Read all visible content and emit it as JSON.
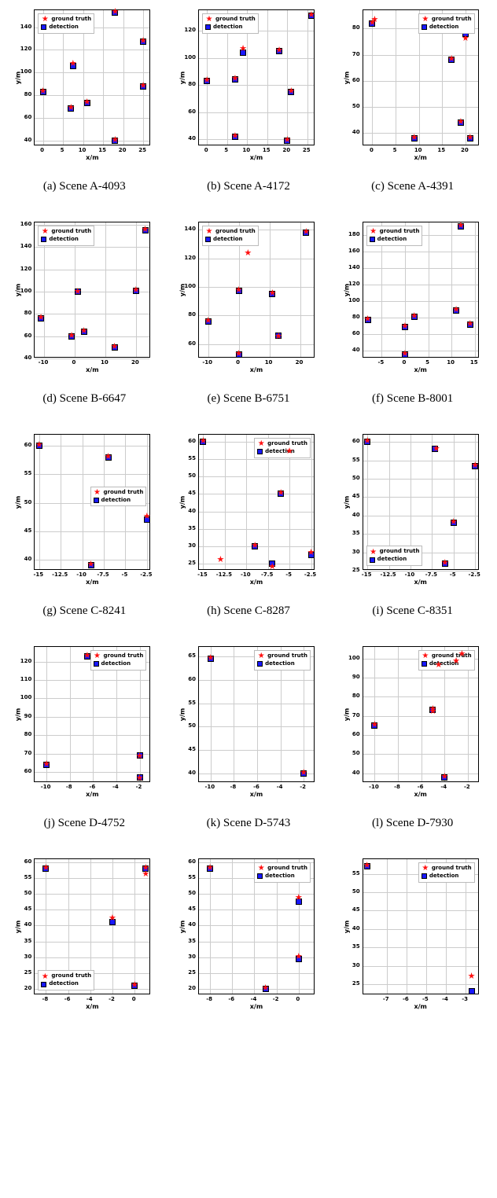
{
  "legend": {
    "gt": "ground truth",
    "det": "detection"
  },
  "xlabel": "x/m",
  "ylabel": "y/m",
  "chart_data": [
    {
      "id": "a",
      "caption": "(a) Scene A-4093",
      "type": "scatter",
      "xlabel": "x/m",
      "ylabel": "y/m",
      "xticks": [
        0,
        5,
        10,
        15,
        20,
        25
      ],
      "yticks": [
        40,
        60,
        80,
        100,
        120,
        140
      ],
      "xlim": [
        -2,
        27
      ],
      "ylim": [
        35,
        155
      ],
      "legend_pos": "upper-left",
      "gt": [
        [
          0,
          83
        ],
        [
          7,
          68
        ],
        [
          7.5,
          107
        ],
        [
          11,
          73
        ],
        [
          18,
          40
        ],
        [
          18,
          153
        ],
        [
          25,
          88
        ],
        [
          25,
          127
        ]
      ],
      "det": [
        [
          0,
          83
        ],
        [
          7,
          68
        ],
        [
          7.5,
          106
        ],
        [
          11,
          73
        ],
        [
          18,
          40
        ],
        [
          18,
          153
        ],
        [
          25,
          88
        ],
        [
          25,
          127
        ]
      ]
    },
    {
      "id": "b",
      "caption": "(b) Scene A-4172",
      "type": "scatter",
      "xlabel": "x/m",
      "ylabel": "y/m",
      "xticks": [
        0,
        5,
        10,
        15,
        20,
        25
      ],
      "yticks": [
        40,
        60,
        80,
        100,
        120
      ],
      "xlim": [
        -2,
        27
      ],
      "ylim": [
        35,
        135
      ],
      "legend_pos": "upper-left",
      "gt": [
        [
          0,
          83
        ],
        [
          7,
          42
        ],
        [
          7,
          84
        ],
        [
          9,
          106
        ],
        [
          18,
          105
        ],
        [
          20,
          39
        ],
        [
          21,
          75
        ],
        [
          26,
          131
        ]
      ],
      "det": [
        [
          0,
          83
        ],
        [
          7,
          42
        ],
        [
          7,
          84
        ],
        [
          9,
          104
        ],
        [
          18,
          105
        ],
        [
          20,
          39
        ],
        [
          21,
          75
        ],
        [
          26,
          131
        ]
      ]
    },
    {
      "id": "c",
      "caption": "(c) Scene A-4391",
      "type": "scatter",
      "xlabel": "x/m",
      "ylabel": "y/m",
      "xticks": [
        0,
        5,
        10,
        15,
        20
      ],
      "yticks": [
        40,
        50,
        60,
        70,
        80
      ],
      "xlim": [
        -2,
        23
      ],
      "ylim": [
        35,
        87
      ],
      "legend_pos": "upper-right",
      "gt": [
        [
          0,
          82
        ],
        [
          0.5,
          83
        ],
        [
          9,
          38
        ],
        [
          17,
          68
        ],
        [
          19,
          44
        ],
        [
          20,
          76
        ],
        [
          21,
          38
        ]
      ],
      "det": [
        [
          0,
          82
        ],
        [
          9,
          38
        ],
        [
          17,
          68
        ],
        [
          19,
          44
        ],
        [
          20,
          78
        ],
        [
          21,
          38
        ]
      ]
    },
    {
      "id": "d",
      "caption": "(d) Scene B-6647",
      "type": "scatter",
      "xlabel": "x/m",
      "ylabel": "y/m",
      "xticks": [
        -10,
        0,
        10,
        20
      ],
      "yticks": [
        40,
        60,
        80,
        100,
        120,
        140,
        160
      ],
      "xlim": [
        -13,
        25
      ],
      "ylim": [
        40,
        162
      ],
      "legend_pos": "upper-left",
      "gt": [
        [
          -11,
          76
        ],
        [
          -1,
          60
        ],
        [
          1,
          99
        ],
        [
          3,
          64
        ],
        [
          13,
          50
        ],
        [
          20,
          101
        ],
        [
          23,
          155
        ]
      ],
      "det": [
        [
          -11,
          76
        ],
        [
          -1,
          60
        ],
        [
          1,
          100
        ],
        [
          3,
          64
        ],
        [
          13,
          50
        ],
        [
          20,
          101
        ],
        [
          23,
          155
        ]
      ]
    },
    {
      "id": "e",
      "caption": "(e) Scene B-6751",
      "type": "scatter",
      "xlabel": "x/m",
      "ylabel": "y/m",
      "xticks": [
        -10,
        0,
        10,
        20
      ],
      "yticks": [
        60,
        80,
        100,
        120,
        140
      ],
      "xlim": [
        -13,
        25
      ],
      "ylim": [
        50,
        145
      ],
      "legend_pos": "upper-left",
      "gt": [
        [
          -10,
          76
        ],
        [
          0,
          53
        ],
        [
          0,
          97
        ],
        [
          3,
          123
        ],
        [
          11,
          95
        ],
        [
          13,
          65
        ],
        [
          22,
          138
        ]
      ],
      "det": [
        [
          -10,
          76
        ],
        [
          0,
          53
        ],
        [
          0,
          97
        ],
        [
          11,
          95
        ],
        [
          13,
          66
        ],
        [
          22,
          138
        ]
      ]
    },
    {
      "id": "f",
      "caption": "(f) Scene B-8001",
      "type": "scatter",
      "xlabel": "x/m",
      "ylabel": "y/m",
      "xticks": [
        -5,
        0,
        5,
        10,
        15
      ],
      "yticks": [
        40,
        60,
        80,
        100,
        120,
        140,
        160,
        180
      ],
      "xlim": [
        -9,
        16
      ],
      "ylim": [
        30,
        195
      ],
      "legend_pos": "upper-left",
      "gt": [
        [
          -8,
          77
        ],
        [
          0,
          35
        ],
        [
          0,
          68
        ],
        [
          2,
          81
        ],
        [
          11,
          88
        ],
        [
          12,
          190
        ],
        [
          14,
          71
        ]
      ],
      "det": [
        [
          -8,
          77
        ],
        [
          0,
          35
        ],
        [
          0,
          68
        ],
        [
          2,
          81
        ],
        [
          11,
          88
        ],
        [
          12,
          190
        ],
        [
          14,
          71
        ]
      ]
    },
    {
      "id": "g",
      "caption": "(g) Scene C-8241",
      "type": "scatter",
      "xlabel": "x/m",
      "ylabel": "y/m",
      "xticks": [
        -15.0,
        -12.5,
        -10.0,
        -7.5,
        -5.0,
        -2.5
      ],
      "yticks": [
        40,
        45,
        50,
        55,
        60
      ],
      "xlim": [
        -15.5,
        -2
      ],
      "ylim": [
        38,
        62
      ],
      "legend_pos": "center-right",
      "gt": [
        [
          -15,
          60
        ],
        [
          -9,
          39
        ],
        [
          -7,
          58
        ],
        [
          -2.5,
          47.5
        ]
      ],
      "det": [
        [
          -15,
          60
        ],
        [
          -9,
          39
        ],
        [
          -7,
          58
        ],
        [
          -2.5,
          47
        ]
      ]
    },
    {
      "id": "h",
      "caption": "(h) Scene C-8287",
      "type": "scatter",
      "xlabel": "x/m",
      "ylabel": "y/m",
      "xticks": [
        -15.0,
        -12.5,
        -10.0,
        -7.5,
        -5.0,
        -2.5
      ],
      "yticks": [
        25,
        30,
        35,
        40,
        45,
        50,
        55,
        60
      ],
      "xlim": [
        -15.5,
        -2
      ],
      "ylim": [
        23,
        62
      ],
      "legend_pos": "upper-right",
      "gt": [
        [
          -15,
          60
        ],
        [
          -13,
          26
        ],
        [
          -9,
          30
        ],
        [
          -7,
          24
        ],
        [
          -6,
          45
        ],
        [
          -5,
          57
        ],
        [
          -2.5,
          28
        ]
      ],
      "det": [
        [
          -15,
          60
        ],
        [
          -9,
          30
        ],
        [
          -7,
          25
        ],
        [
          -6,
          45
        ],
        [
          -5,
          56.5
        ],
        [
          -2.5,
          27.5
        ]
      ]
    },
    {
      "id": "i",
      "caption": "(i) Scene C-8351",
      "type": "scatter",
      "xlabel": "x/m",
      "ylabel": "y/m",
      "xticks": [
        -15.0,
        -12.5,
        -10.0,
        -7.5,
        -5.0,
        -2.5
      ],
      "yticks": [
        25,
        30,
        35,
        40,
        45,
        50,
        55,
        60
      ],
      "xlim": [
        -15.5,
        -2
      ],
      "ylim": [
        25,
        62
      ],
      "legend_pos": "lower-left",
      "gt": [
        [
          -15,
          60
        ],
        [
          -7,
          58
        ],
        [
          -6,
          27
        ],
        [
          -5,
          38
        ],
        [
          -2.5,
          53.5
        ]
      ],
      "det": [
        [
          -15,
          60
        ],
        [
          -7.2,
          58.2
        ],
        [
          -6,
          27
        ],
        [
          -5,
          38
        ],
        [
          -2.5,
          53.5
        ]
      ]
    },
    {
      "id": "j",
      "caption": "(j) Scene D-4752",
      "type": "scatter",
      "xlabel": "x/m",
      "ylabel": "y/m",
      "xticks": [
        -10,
        -8,
        -6,
        -4,
        -2
      ],
      "yticks": [
        60,
        70,
        80,
        90,
        100,
        110,
        120
      ],
      "xlim": [
        -11,
        -1
      ],
      "ylim": [
        54,
        128
      ],
      "legend_pos": "upper-right",
      "gt": [
        [
          -10,
          64
        ],
        [
          -6.5,
          123
        ],
        [
          -2,
          56
        ],
        [
          -2,
          68
        ]
      ],
      "det": [
        [
          -10,
          64
        ],
        [
          -6.5,
          123
        ],
        [
          -2,
          57
        ],
        [
          -2,
          69
        ]
      ]
    },
    {
      "id": "k",
      "caption": "(k) Scene D-5743",
      "type": "scatter",
      "xlabel": "x/m",
      "ylabel": "y/m",
      "xticks": [
        -10,
        -8,
        -6,
        -4,
        -2
      ],
      "yticks": [
        40,
        45,
        50,
        55,
        60,
        65
      ],
      "xlim": [
        -11,
        -1
      ],
      "ylim": [
        38,
        67
      ],
      "legend_pos": "upper-right",
      "gt": [
        [
          -10,
          64.5
        ],
        [
          -2,
          40
        ]
      ],
      "det": [
        [
          -10,
          64.5
        ],
        [
          -2,
          40
        ]
      ]
    },
    {
      "id": "l",
      "caption": "(l) Scene D-7930",
      "type": "scatter",
      "xlabel": "x/m",
      "ylabel": "y/m",
      "xticks": [
        -10,
        -8,
        -6,
        -4,
        -2
      ],
      "yticks": [
        40,
        50,
        60,
        70,
        80,
        90,
        100
      ],
      "xlim": [
        -11,
        -1
      ],
      "ylim": [
        35,
        106
      ],
      "legend_pos": "upper-right",
      "gt": [
        [
          -10,
          65
        ],
        [
          -5,
          73
        ],
        [
          -5,
          72
        ],
        [
          -4.5,
          96
        ],
        [
          -3,
          98
        ],
        [
          -2.5,
          102
        ],
        [
          -4,
          38
        ]
      ],
      "det": [
        [
          -10,
          65
        ],
        [
          -5,
          73
        ],
        [
          -4.5,
          97.5
        ],
        [
          -3,
          98
        ],
        [
          -2.5,
          102
        ],
        [
          -4,
          38
        ]
      ]
    },
    {
      "id": "m",
      "caption": "",
      "type": "scatter",
      "xlabel": "x/m",
      "ylabel": "y/m",
      "xticks": [
        -8,
        -6,
        -4,
        -2,
        0
      ],
      "yticks": [
        20,
        25,
        30,
        35,
        40,
        45,
        50,
        55,
        60
      ],
      "xlim": [
        -9,
        1.5
      ],
      "ylim": [
        18,
        61
      ],
      "legend_pos": "lower-left",
      "gt": [
        [
          -8,
          58
        ],
        [
          -2,
          42
        ],
        [
          0,
          21
        ],
        [
          1,
          56
        ],
        [
          1,
          58
        ]
      ],
      "det": [
        [
          -8,
          58
        ],
        [
          -2,
          41
        ],
        [
          0,
          21
        ],
        [
          1,
          58
        ]
      ]
    },
    {
      "id": "n",
      "caption": "",
      "type": "scatter",
      "xlabel": "x/m",
      "ylabel": "y/m",
      "xticks": [
        -8,
        -6,
        -4,
        -2,
        0
      ],
      "yticks": [
        20,
        25,
        30,
        35,
        40,
        45,
        50,
        55,
        60
      ],
      "xlim": [
        -9,
        1.5
      ],
      "ylim": [
        18,
        61
      ],
      "legend_pos": "upper-right",
      "gt": [
        [
          -8,
          58
        ],
        [
          -3,
          20
        ],
        [
          0,
          30
        ],
        [
          0,
          48.5
        ]
      ],
      "det": [
        [
          -8,
          58
        ],
        [
          -3,
          20
        ],
        [
          0,
          29.5
        ],
        [
          0,
          47.5
        ]
      ]
    },
    {
      "id": "o",
      "caption": "",
      "type": "scatter",
      "xlabel": "x/m",
      "ylabel": "y/m",
      "xticks": [
        -7,
        -6,
        -5,
        -4,
        -3
      ],
      "yticks": [
        25,
        30,
        35,
        40,
        45,
        50,
        55
      ],
      "xlim": [
        -8.2,
        -2.3
      ],
      "ylim": [
        22,
        59
      ],
      "legend_pos": "upper-right",
      "gt": [
        [
          -8,
          57
        ],
        [
          -2.7,
          27
        ]
      ],
      "det": [
        [
          -8,
          57
        ],
        [
          -2.7,
          23
        ]
      ]
    }
  ]
}
